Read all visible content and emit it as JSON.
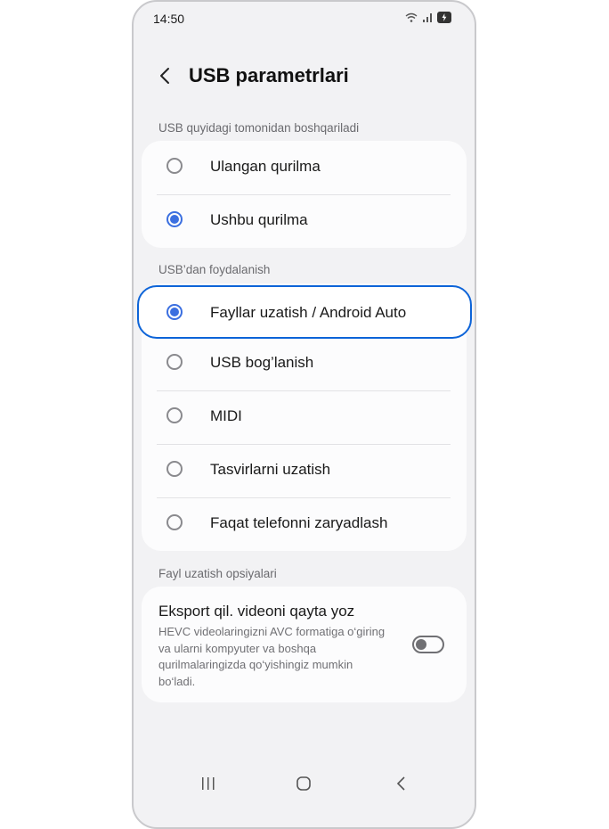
{
  "status_bar": {
    "time": "14:50"
  },
  "header": {
    "title": "USB parametrlari"
  },
  "sections": [
    {
      "label": "USB quyidagi tomonidan boshqariladi",
      "options": [
        {
          "label": "Ulangan qurilma",
          "selected": false
        },
        {
          "label": "Ushbu qurilma",
          "selected": true
        }
      ]
    },
    {
      "label": "USB’dan foydalanish",
      "options": [
        {
          "label": "Fayllar uzatish / Android Auto",
          "selected": true
        },
        {
          "label": "USB bog’lanish",
          "selected": false
        },
        {
          "label": "MIDI",
          "selected": false
        },
        {
          "label": "Tasvirlarni uzatish",
          "selected": false
        },
        {
          "label": "Faqat telefonni zaryadlash",
          "selected": false
        }
      ]
    },
    {
      "label": "Fayl uzatish opsiyalari",
      "setting": {
        "title": "Eksport qil. videoni qayta yoz",
        "description": "HEVC videolaringizni AVC formatiga o‘giring va ularni kompyuter va boshqa qurilmalaringizda qo‘yishingiz mumkin bo‘ladi.",
        "enabled": false
      }
    }
  ],
  "colors": {
    "accent": "#3b6fe0",
    "highlight": "#0d64d8"
  }
}
